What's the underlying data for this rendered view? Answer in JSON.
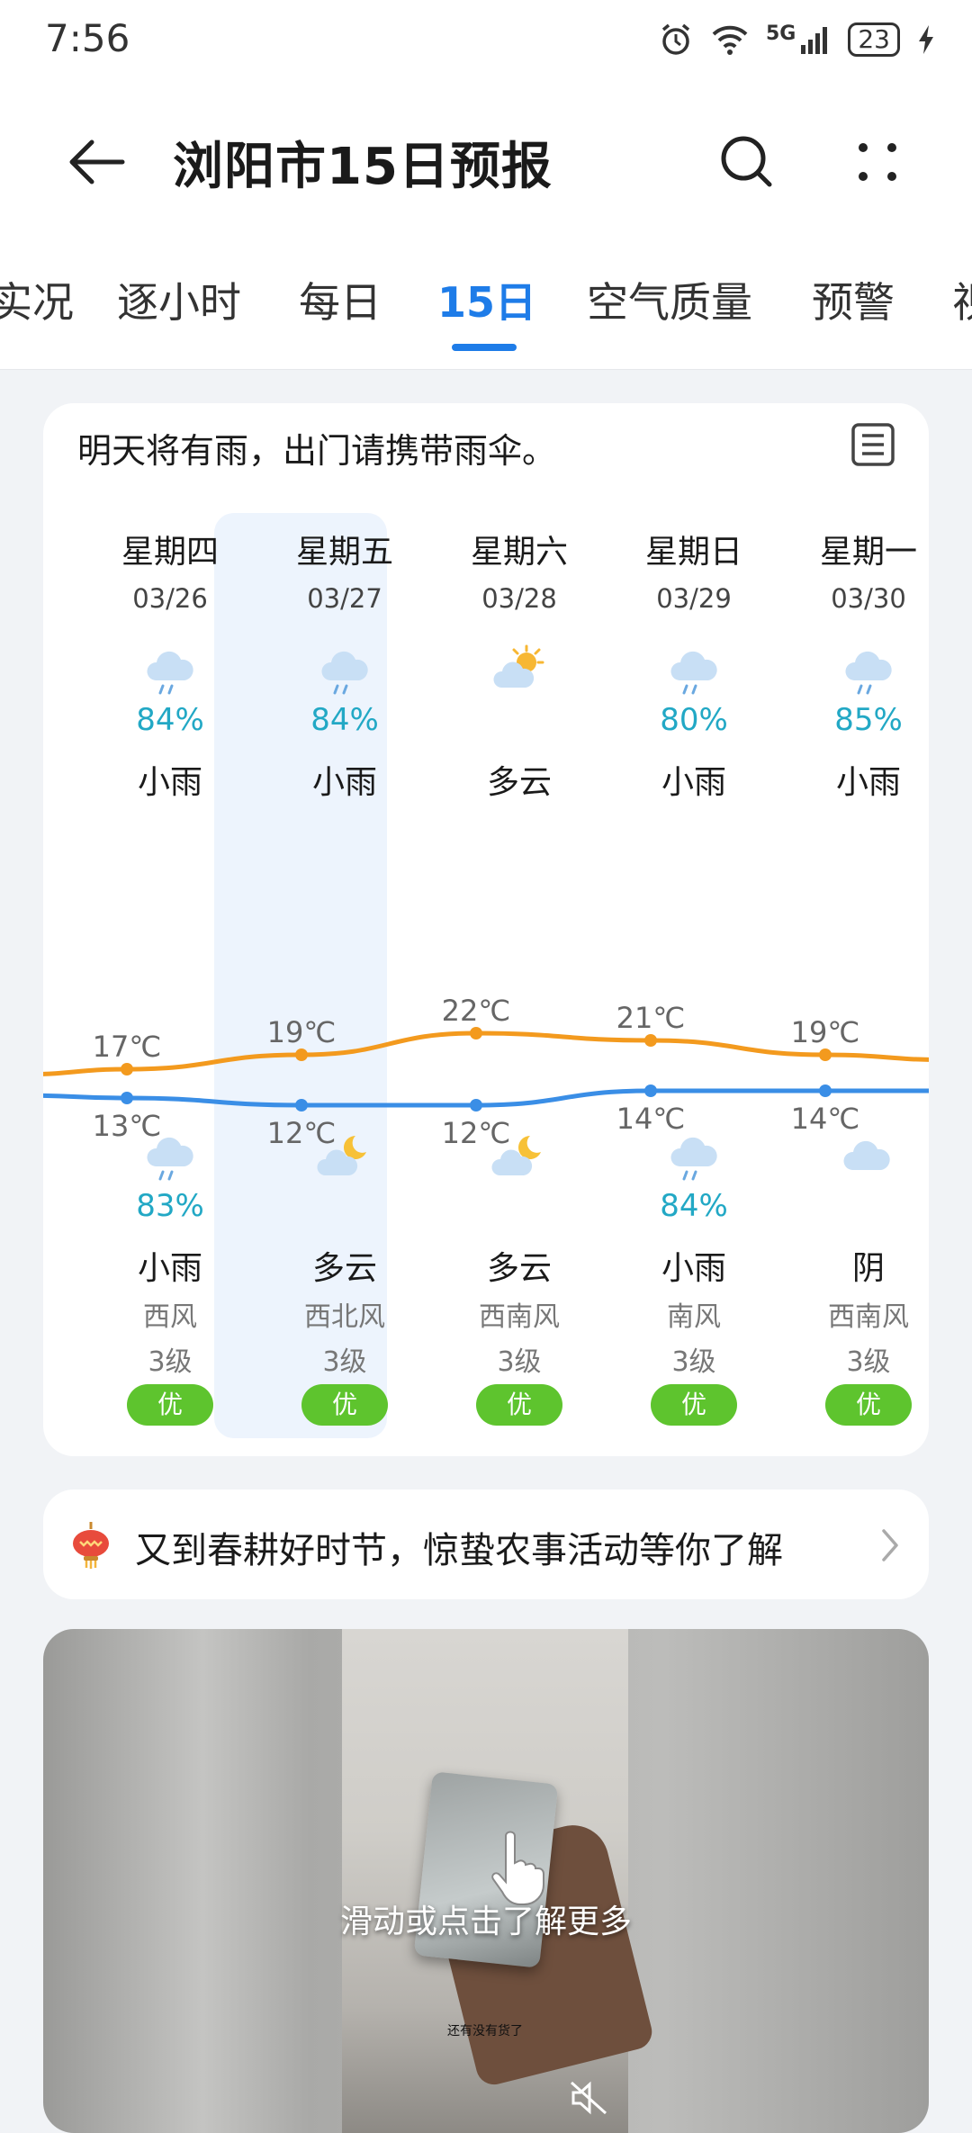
{
  "status_bar": {
    "time": "7:56",
    "network": "5G",
    "battery": "23"
  },
  "header": {
    "title": "浏阳市15日预报"
  },
  "tabs": [
    {
      "label": "实况"
    },
    {
      "label": "逐小时"
    },
    {
      "label": "每日"
    },
    {
      "label": "15日",
      "active": true
    },
    {
      "label": "空气质量"
    },
    {
      "label": "预警"
    },
    {
      "label": "视"
    }
  ],
  "forecast": {
    "tip": "明天将有雨，出门请携带雨伞。",
    "days": [
      {
        "weekday": "星期四",
        "date": "03/26",
        "day_icon": "rain-cloud-icon",
        "day_precip": "84%",
        "day_condition": "小雨",
        "high": "17℃",
        "low": "13℃",
        "night_icon": "rain-cloud-icon",
        "night_precip": "83%",
        "night_condition": "小雨",
        "wind_dir": "西风",
        "wind_level": "3级",
        "aqi": "优"
      },
      {
        "weekday": "星期五",
        "date": "03/27",
        "day_icon": "rain-cloud-icon",
        "day_precip": "84%",
        "day_condition": "小雨",
        "high": "19℃",
        "low": "12℃",
        "night_icon": "moon-cloud-icon",
        "night_precip": "",
        "night_condition": "多云",
        "wind_dir": "西北风",
        "wind_level": "3级",
        "aqi": "优",
        "selected": true
      },
      {
        "weekday": "星期六",
        "date": "03/28",
        "day_icon": "sun-cloud-icon",
        "day_precip": "",
        "day_condition": "多云",
        "high": "22℃",
        "low": "12℃",
        "night_icon": "moon-cloud-icon",
        "night_precip": "",
        "night_condition": "多云",
        "wind_dir": "西南风",
        "wind_level": "3级",
        "aqi": "优"
      },
      {
        "weekday": "星期日",
        "date": "03/29",
        "day_icon": "rain-cloud-icon",
        "day_precip": "80%",
        "day_condition": "小雨",
        "high": "21℃",
        "low": "14℃",
        "night_icon": "rain-cloud-icon",
        "night_precip": "84%",
        "night_condition": "小雨",
        "wind_dir": "南风",
        "wind_level": "3级",
        "aqi": "优"
      },
      {
        "weekday": "星期一",
        "date": "03/30",
        "day_icon": "rain-cloud-icon",
        "day_precip": "85%",
        "day_condition": "小雨",
        "high": "19℃",
        "low": "14℃",
        "night_icon": "overcast-cloud-icon",
        "night_precip": "",
        "night_condition": "阴",
        "wind_dir": "西南风",
        "wind_level": "3级",
        "aqi": "优"
      }
    ],
    "high_temps": [
      17,
      19,
      22,
      21,
      19
    ],
    "low_temps": [
      13,
      12,
      12,
      14,
      14
    ],
    "colors": {
      "high_line": "#f39a1e",
      "low_line": "#3a8ee6",
      "aqi_good": "#5ec42e",
      "precip": "#22a8c5"
    }
  },
  "promo": {
    "text": "又到春耕好时节，惊蛰农事活动等你了解"
  },
  "ad": {
    "overlay_text": "滑动或点击了解更多",
    "caption": "还有没有货了"
  }
}
